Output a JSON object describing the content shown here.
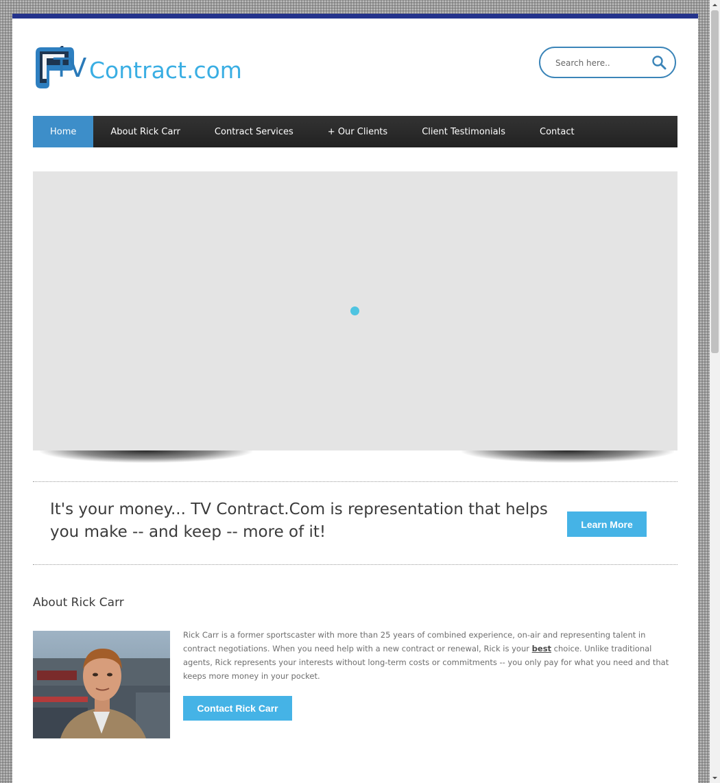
{
  "header": {
    "logo_tv": "TV",
    "logo_rest": "Contract.com",
    "search": {
      "placeholder": "Search here.."
    }
  },
  "nav": {
    "items": [
      {
        "label": "Home",
        "active": true
      },
      {
        "label": "About Rick Carr"
      },
      {
        "label": "Contract Services"
      },
      {
        "label": "+ Our Clients"
      },
      {
        "label": "Client Testimonials"
      },
      {
        "label": "Contact"
      }
    ]
  },
  "tagline": {
    "text": "It's your money... TV Contract.Com is representation that helps you make -- and keep -- more of it!",
    "button": "Learn More"
  },
  "about": {
    "title": "About Rick Carr",
    "text_before_best": "Rick Carr is a former sportscaster with more than 25 years of combined experience, on-air and representing talent in contract negotiations. When you need help with a new contract or renewal, Rick is your ",
    "best": "best",
    "text_after_best": " choice. Unlike traditional agents, Rick represents your interests without long-term costs or commitments -- you only pay for what you need and that keeps more money in your pocket.",
    "button": "Contact Rick Carr"
  },
  "colors": {
    "accent": "#45b3e6",
    "nav_active": "#3d8ec9",
    "top_border": "#24338c",
    "logo_dark": "#2a7ab9",
    "logo_light": "#3aaee3"
  },
  "icons": {
    "logo": "tv-antenna-icon",
    "search": "search-icon"
  }
}
